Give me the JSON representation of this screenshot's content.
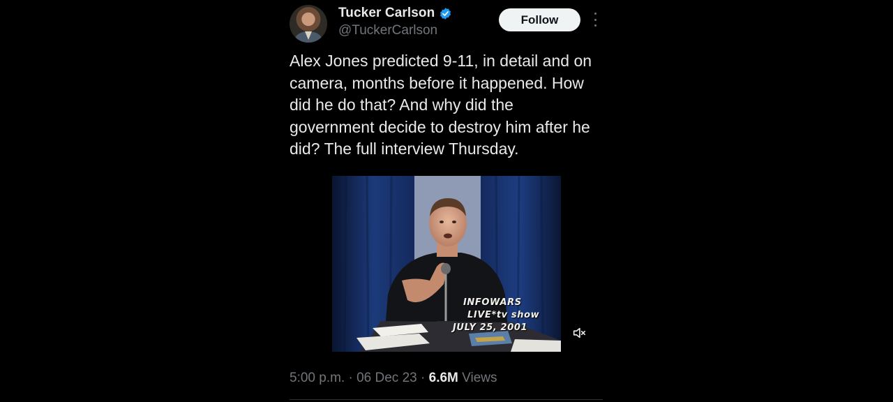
{
  "author": {
    "display_name": "Tucker Carlson",
    "handle": "@TuckerCarlson",
    "verified": true,
    "verified_color": "#1d9bf0"
  },
  "follow_label": "Follow",
  "more_icon": "more-horizontal-icon",
  "tweet_text": "Alex Jones predicted 9-11, in detail and on camera, months before it happened. How did he do that? And why did the government decide to destroy him after he did? The full interview Thursday.",
  "video": {
    "caption_line1": "INFOWARS",
    "caption_line2": "LIVE*tv show",
    "caption_line3": "JULY 25, 2001",
    "muted": true,
    "mute_icon": "volume-muted-icon"
  },
  "meta": {
    "time": "5:00 p.m.",
    "separator": " · ",
    "date": "06 Dec 23",
    "views_count": "6.6M",
    "views_label": "Views"
  },
  "colors": {
    "background": "#000000",
    "text": "#e7e9ea",
    "secondary": "#71767b",
    "button_bg": "#eff3f4",
    "accent": "#1d9bf0"
  }
}
